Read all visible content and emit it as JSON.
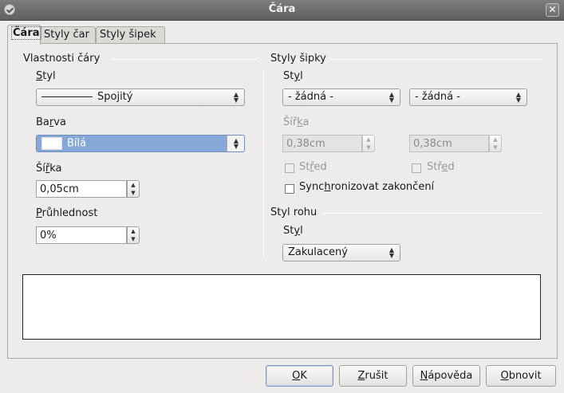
{
  "window": {
    "title": "Čára",
    "close_glyph": "✕"
  },
  "tabs": [
    {
      "label": "Čára",
      "active": true
    },
    {
      "label": "Styly čar",
      "active": false
    },
    {
      "label": "Styly šipek",
      "active": false
    }
  ],
  "line_props": {
    "section_title": "Vlastnosti čáry",
    "style_label": "Styl",
    "style_value": "Spojitý",
    "color_label": "Barva",
    "color_value": "Bílá",
    "width_label": "Šířka",
    "width_value": "0,05cm",
    "transparency_label": "Průhlednost",
    "transparency_value": "0%"
  },
  "arrow_styles": {
    "section_title": "Styly šipky",
    "style_label": "Styl",
    "start_style": "- žádná -",
    "end_style": "- žádná -",
    "width_label": "Šířka",
    "start_width": "0,38cm",
    "end_width": "0,38cm",
    "center_label": "Střed",
    "sync_label": "Synchronizovat zakončení"
  },
  "corner_style": {
    "section_title": "Styl rohu",
    "style_label": "Styl",
    "style_value": "Zakulacený"
  },
  "buttons": {
    "ok": "OK",
    "cancel": "Zrušit",
    "help": "Nápověda",
    "reset": "Obnovit"
  },
  "icons": {
    "updown": "updown-arrows-icon",
    "checkbox": "checkbox-icon",
    "close": "close-icon",
    "menu": "window-menu-icon"
  }
}
